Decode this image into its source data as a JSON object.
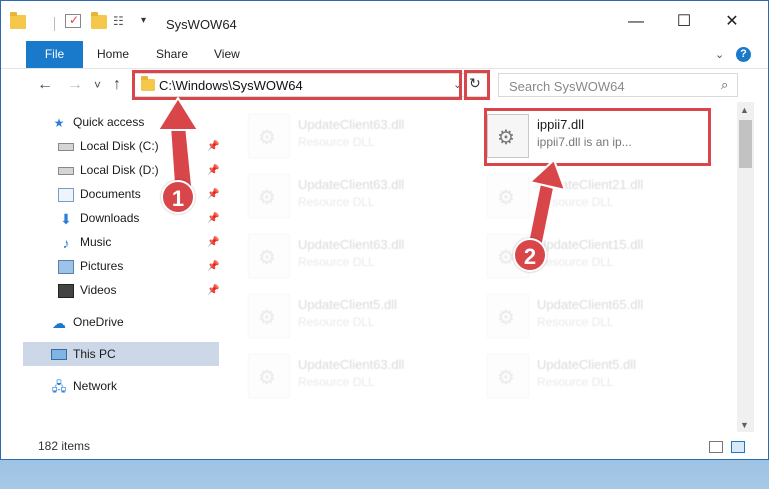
{
  "window": {
    "title": "SysWOW64",
    "controls": {
      "minimize": "—",
      "maximize": "☐",
      "close": "✕"
    }
  },
  "ribbon": {
    "tabs": [
      "File",
      "Home",
      "Share",
      "View"
    ],
    "expand_icon": "chevron-down-icon",
    "help_label": "?"
  },
  "navigation": {
    "back": "←",
    "forward": "→",
    "recent": "˅",
    "up": "↑",
    "address": "C:\\Windows\\SysWOW64",
    "search_placeholder": "Search SysWOW64"
  },
  "sidebar": {
    "items": [
      {
        "label": "Quick access",
        "icon": "star-icon"
      },
      {
        "label": "Local Disk (C:)",
        "icon": "drive-icon",
        "pinned": true
      },
      {
        "label": "Local Disk (D:)",
        "icon": "drive-icon",
        "pinned": true
      },
      {
        "label": "Documents",
        "icon": "documents-icon",
        "pinned": true
      },
      {
        "label": "Downloads",
        "icon": "download-icon",
        "pinned": true
      },
      {
        "label": "Music",
        "icon": "music-icon",
        "pinned": true
      },
      {
        "label": "Pictures",
        "icon": "pictures-icon",
        "pinned": true
      },
      {
        "label": "Videos",
        "icon": "videos-icon",
        "pinned": true
      },
      {
        "label": "OneDrive",
        "icon": "cloud-icon"
      },
      {
        "label": "This PC",
        "icon": "computer-icon",
        "selected": true
      },
      {
        "label": "Network",
        "icon": "network-icon"
      }
    ]
  },
  "files": {
    "left_column": [
      {
        "name": "UpdateClient63.dll",
        "desc": "Resource DLL"
      },
      {
        "name": "UpdateClient63.dll",
        "desc": "Resource DLL"
      },
      {
        "name": "UpdateClient63.dll",
        "desc": "Resource DLL"
      },
      {
        "name": "UpdateClient5.dll",
        "desc": "Resource DLL"
      },
      {
        "name": "UpdateClient63.dll",
        "desc": "Resource DLL"
      }
    ],
    "highlighted": {
      "name": "ippii7.dll",
      "desc": "ippii7.dll is an ip..."
    },
    "right_column": [
      {
        "name": "UpdateClient21.dll",
        "desc": "Resource DLL"
      },
      {
        "name": "UpdateClient15.dll",
        "desc": "Resource DLL"
      },
      {
        "name": "UpdateClient65.dll",
        "desc": "Resource DLL"
      },
      {
        "name": "UpdateClient5.dll",
        "desc": "Resource DLL"
      }
    ]
  },
  "status": {
    "items": "182 items"
  },
  "callouts": {
    "one": "1",
    "two": "2"
  },
  "colors": {
    "accent": "#1979ca",
    "highlight": "#d8464a",
    "selection": "#ccd8e8"
  }
}
